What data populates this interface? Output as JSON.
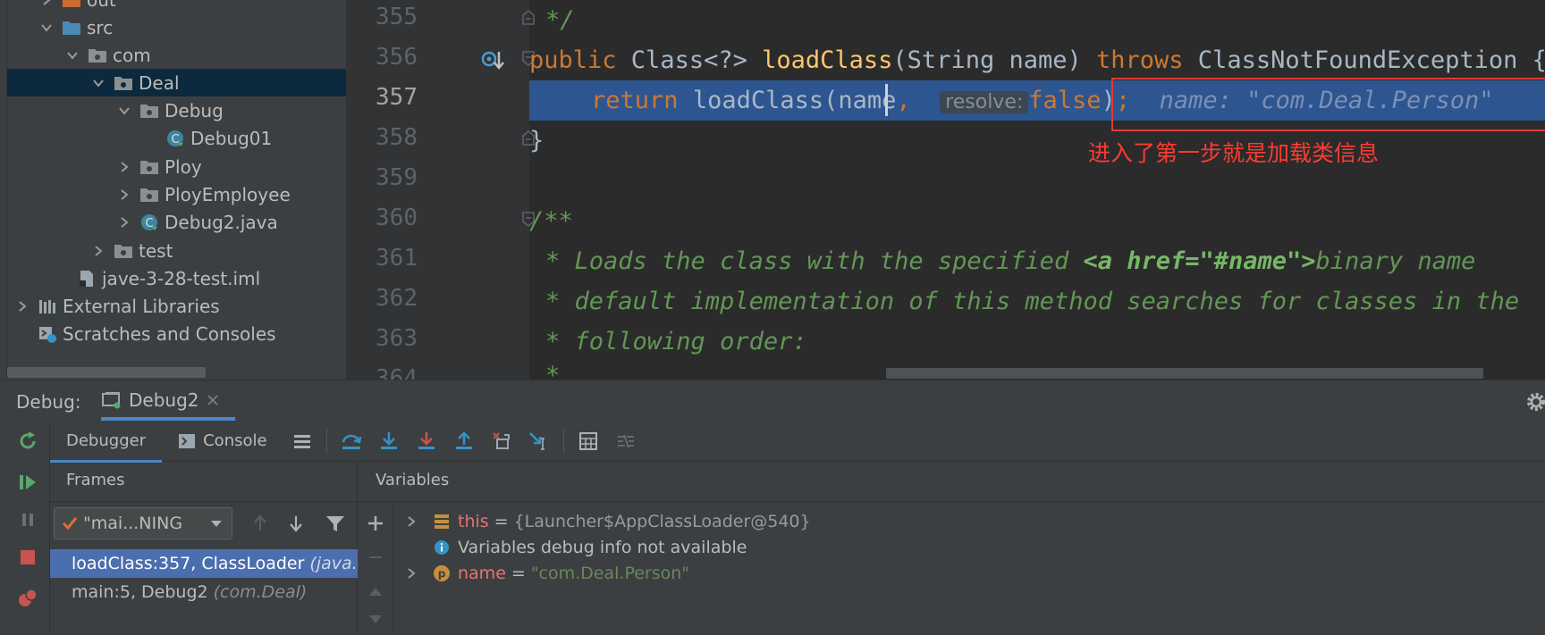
{
  "project": {
    "items": [
      {
        "label": "out",
        "icon": "folder-orange-icon"
      },
      {
        "label": "src",
        "icon": "folder-blue-icon"
      },
      {
        "label": "com",
        "icon": "package-icon"
      },
      {
        "label": "Deal",
        "icon": "package-icon"
      },
      {
        "label": "Debug",
        "icon": "package-icon"
      },
      {
        "label": "Debug01",
        "icon": "java-class-icon"
      },
      {
        "label": "Ploy",
        "icon": "package-icon"
      },
      {
        "label": "PloyEmployee",
        "icon": "package-icon"
      },
      {
        "label": "Debug2.java",
        "icon": "java-class-icon"
      },
      {
        "label": "test",
        "icon": "package-icon"
      },
      {
        "label": "jave-3-28-test.iml",
        "icon": "iml-file-icon"
      },
      {
        "label": "External Libraries",
        "icon": "libraries-icon"
      },
      {
        "label": "Scratches and Consoles",
        "icon": "scratches-icon"
      }
    ]
  },
  "editor": {
    "line_numbers": [
      "355",
      "356",
      "357",
      "358",
      "359",
      "360",
      "361",
      "362",
      "363",
      "364"
    ],
    "code": {
      "l355": "*/",
      "l356_kw1": "public",
      "l356_t1": " Class<?> ",
      "l356_fn": "loadClass",
      "l356_t2": "(String name) ",
      "l356_kw2": "throws",
      "l356_t3": " ClassNotFoundException {",
      "l357_kw": "return",
      "l357_call": "loadClass(name",
      "l357_comma": ",",
      "l357_hint": "resolve:",
      "l357_false": "false",
      "l357_close": ")",
      "l357_semi": ";",
      "l357_debug": "name: \"com.Deal.Person\"",
      "l358": "}",
      "l360": "/**",
      "l361_a": "* Loads the class with the specified ",
      "l361_tag": "<a href=\"#name\">",
      "l361_b": "binary name",
      "l362": "* default implementation of this method searches for classes in the",
      "l363": "* following order:",
      "l364": "*"
    },
    "annotation": "进入了第一步就是加载类信息"
  },
  "debug": {
    "label": "Debug:",
    "session_tab": "Debug2",
    "tabs": {
      "debugger": "Debugger",
      "console": "Console"
    },
    "frames_title": "Frames",
    "thread": "\"mai...NING",
    "frames": [
      {
        "method": "loadClass:357, ClassLoader",
        "pkg": "(java.lang)"
      },
      {
        "method": "main:5, Debug2",
        "pkg": "(com.Deal)"
      }
    ],
    "variables_title": "Variables",
    "variables": {
      "this_name": "this",
      "this_value": "{Launcher$AppClassLoader@540}",
      "info": "Variables debug info not available",
      "name_name": "name",
      "name_value": "\"com.Deal.Person\""
    },
    "equals": "="
  },
  "colors": {
    "editor_bg": "#2b2b2b",
    "panel_bg": "#3c3f41",
    "selection": "#2d5590",
    "frame_selected": "#4b6eaf",
    "annotation_red": "#e53935"
  }
}
